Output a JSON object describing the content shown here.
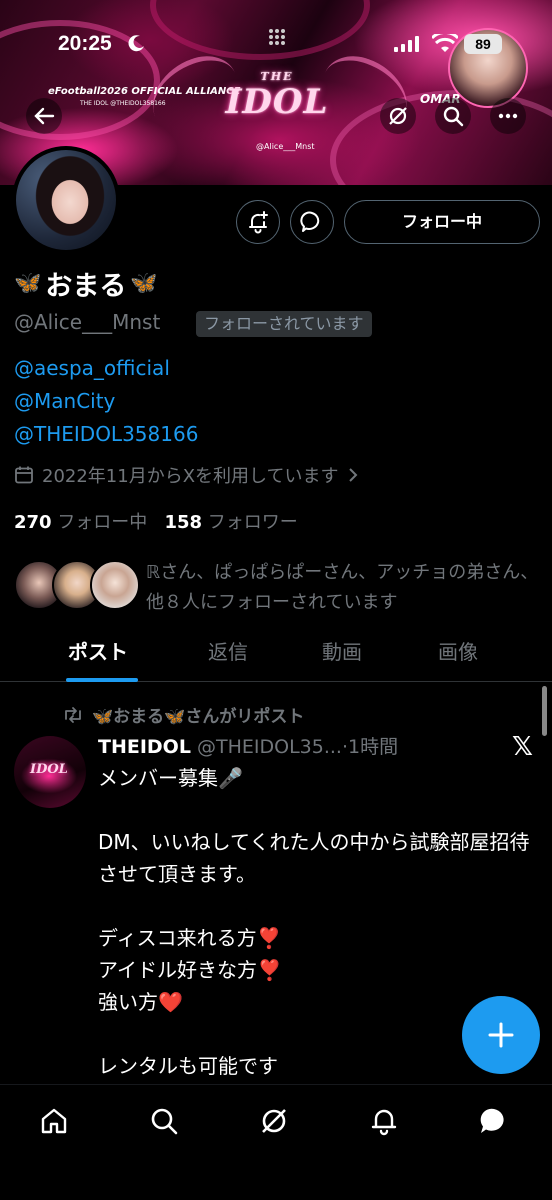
{
  "status_bar": {
    "time": "20:25",
    "battery": "89"
  },
  "banner": {
    "tagline": "eFootball2026 OFFICIAL ALLIANCE",
    "tagline_small": "THE IDOL @THEIDOL358166",
    "logo_top": "THE",
    "logo_main": "IDOL",
    "handle_small": "@Alice___Mnst",
    "player_name": "OMAR"
  },
  "profile": {
    "display_name": "おまる",
    "name_emoji_left": "🦋",
    "name_emoji_right": "🦋",
    "handle": "@Alice___Mnst",
    "follows_you": "フォローされています",
    "bio_links": [
      "@aespa_official",
      "@ManCity",
      "@THEIDOL358166"
    ],
    "joined": "2022年11月からXを利用しています",
    "following_count": "270",
    "following_label": "フォロー中",
    "followers_count": "158",
    "followers_label": "フォロワー",
    "mutuals_text": "ℝさん、ぱっぱらぱーさん、アッチョの弟さん、他８人にフォローされています",
    "follow_button": "フォロー中"
  },
  "tabs": [
    "ポスト",
    "返信",
    "動画",
    "画像"
  ],
  "post": {
    "repost_label": "🦋おまる🦋さんがリポスト",
    "author": "THEIDOL",
    "author_handle": "@THEIDOL35...",
    "time": "·1時間",
    "avatar_text": "IDOL",
    "text": "メンバー募集🎤\n\nDM、いいねしてくれた人の中から試験部屋招待させて頂きます。\n\nディスコ来れる方❣️\nアイドル好きな方❣️\n強い方❤️\n\nレンタルも可能です"
  },
  "colors": {
    "accent": "#1d9bf0",
    "background": "#000000",
    "muted": "#71767b"
  }
}
